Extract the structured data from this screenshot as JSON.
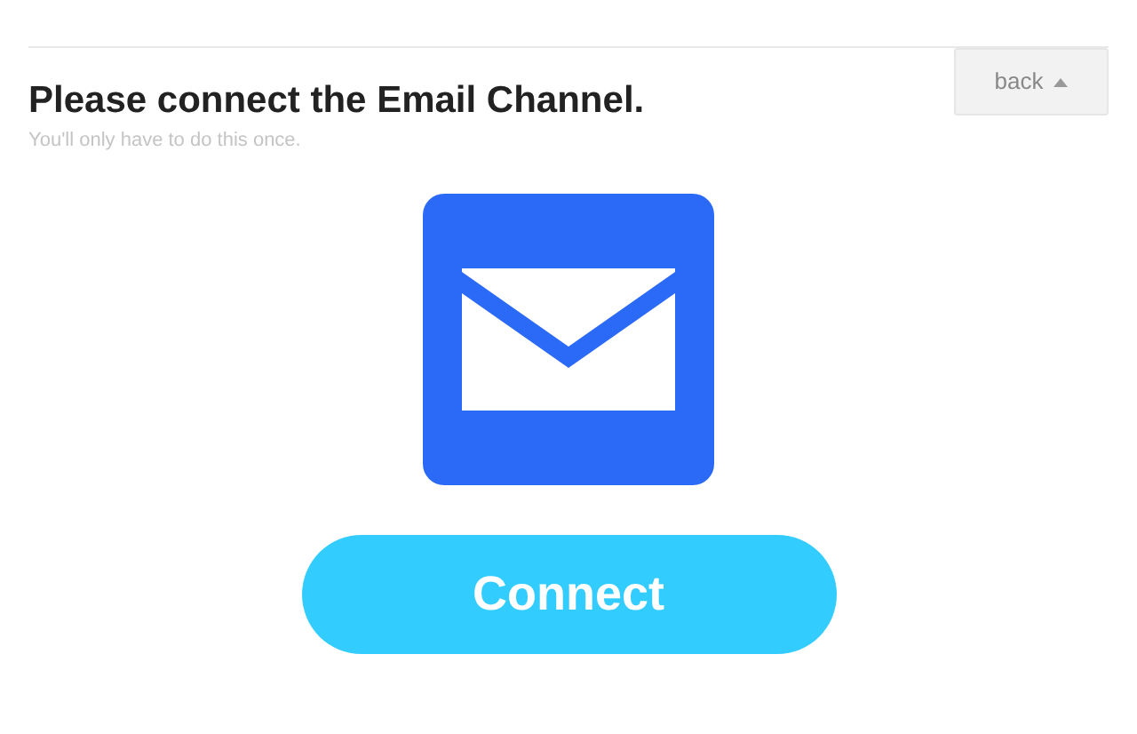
{
  "back_button": {
    "label": "back"
  },
  "title": "Please connect the Email Channel.",
  "subtitle": "You'll only have to do this once.",
  "connect_button": {
    "label": "Connect"
  }
}
